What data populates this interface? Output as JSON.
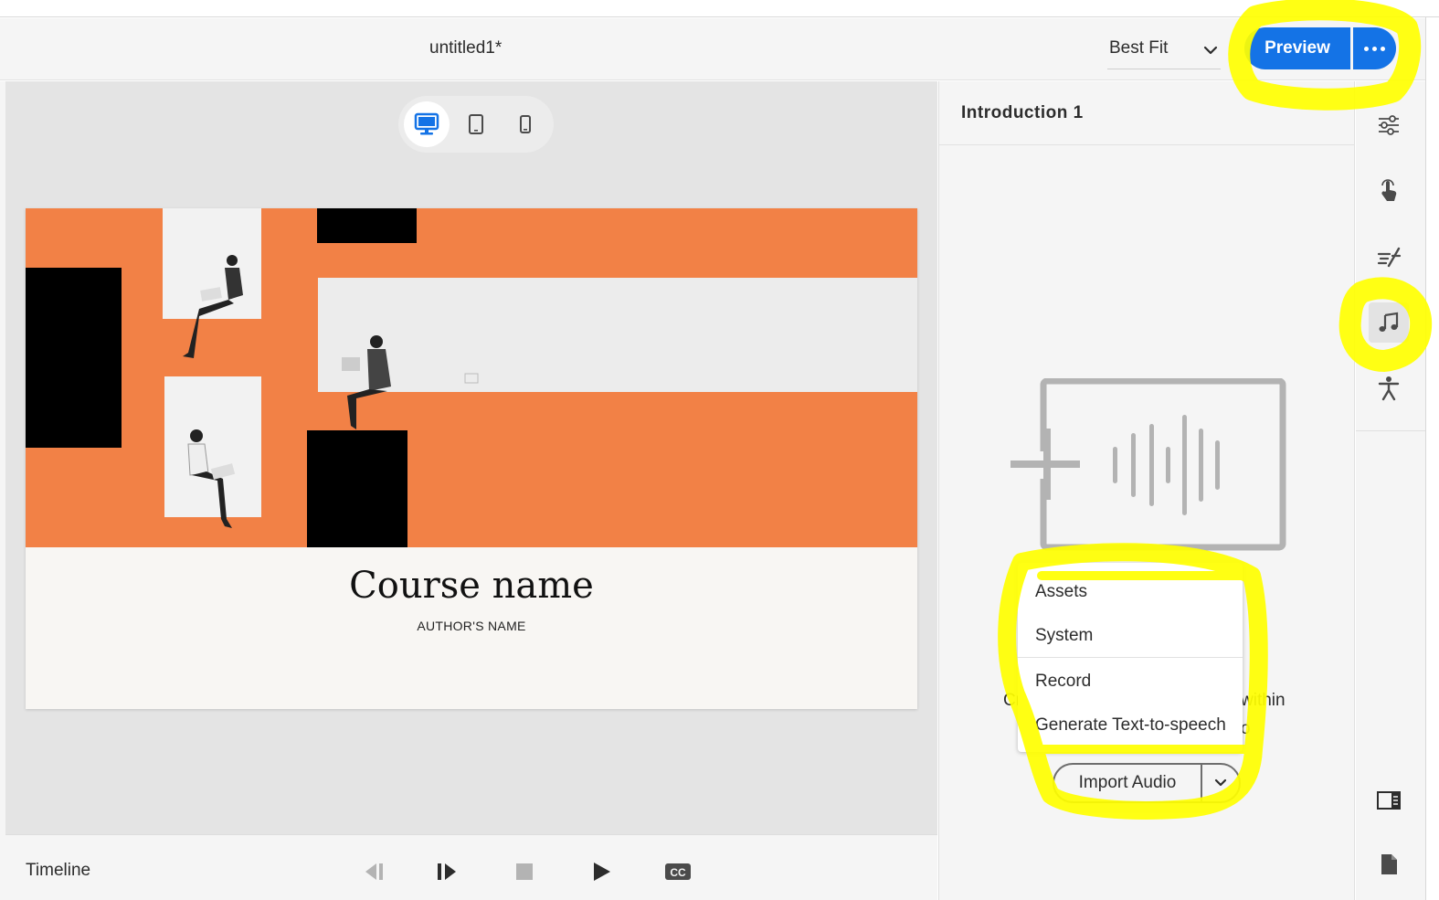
{
  "header": {
    "doc_title": "untitled1*",
    "zoom_value": "Best Fit",
    "preview_label": "Preview"
  },
  "device_toggle": {
    "options": [
      "desktop",
      "tablet",
      "mobile"
    ],
    "selected": "desktop"
  },
  "slide": {
    "course_name": "Course name",
    "author_name": "AUTHOR'S NAME"
  },
  "timeline": {
    "label": "Timeline",
    "controls": [
      "step-back-icon",
      "step-forward-icon",
      "stop-icon",
      "play-icon",
      "cc-icon"
    ]
  },
  "panel": {
    "title": "Introduction 1",
    "hint_left_fragment": "Cr",
    "hint_right_fragment_1": "within",
    "hint_right_fragment_2": "o",
    "menu": {
      "items": [
        "Assets",
        "System",
        "Record",
        "Generate Text-to-speech"
      ]
    },
    "import_button_label": "Import Audio"
  },
  "rail": {
    "items": [
      "properties-icon",
      "interactions-icon",
      "effects-icon",
      "audio-icon",
      "accessibility-icon",
      "slide-panel-icon",
      "document-icon"
    ],
    "active": "audio-icon"
  },
  "colors": {
    "accent": "#1473e6",
    "slide_orange": "#f28146",
    "highlight": "#ffff00"
  }
}
